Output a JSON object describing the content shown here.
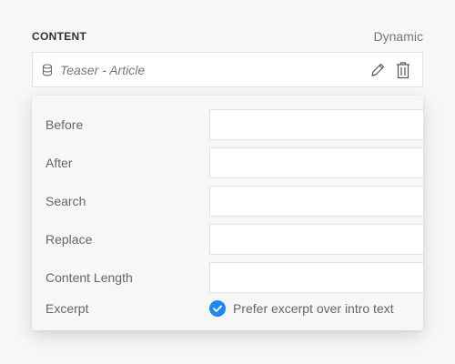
{
  "section": {
    "title": "CONTENT",
    "mode": "Dynamic"
  },
  "source": {
    "label": "Teaser - Article",
    "icon": "database-icon"
  },
  "actions": {
    "edit_icon": "pencil-icon",
    "delete_icon": "trash-icon"
  },
  "fields": [
    {
      "label": "Before",
      "value": ""
    },
    {
      "label": "After",
      "value": ""
    },
    {
      "label": "Search",
      "value": ""
    },
    {
      "label": "Replace",
      "value": ""
    },
    {
      "label": "Content Length",
      "value": ""
    }
  ],
  "excerpt": {
    "label": "Excerpt",
    "option_label": "Prefer excerpt over intro text",
    "checked": true
  },
  "colors": {
    "accent": "#1e87f0",
    "background": "#f7f7f7",
    "input_border": "#e2e2e2"
  }
}
